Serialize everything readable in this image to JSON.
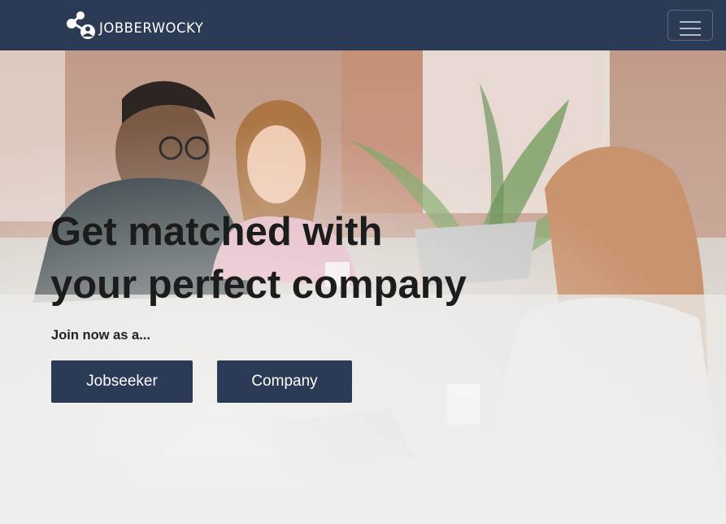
{
  "navbar": {
    "brand_text": "JOBBERWOCKY",
    "logo_icon": "network-person-icon",
    "menu_icon": "hamburger-menu-icon",
    "background_color": "#2b3a55"
  },
  "hero": {
    "headline_line1": "Get matched with",
    "headline_line2": "your perfect company",
    "subline": "Join now as a...",
    "buttons": {
      "jobseeker_label": "Jobseeker",
      "company_label": "Company"
    },
    "background_image": "office-meeting-photo",
    "button_color": "#2b3a55"
  }
}
